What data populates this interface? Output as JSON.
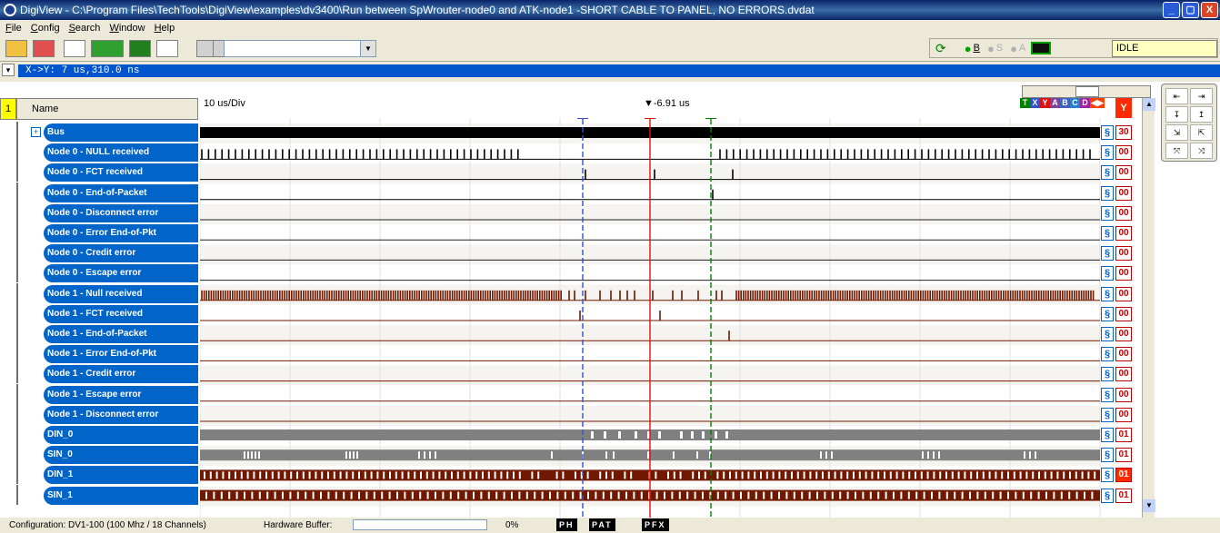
{
  "window": {
    "title": "DigiView - C:\\Program Files\\TechTools\\DigiView\\examples\\dv3400\\Run between SpWrouter-node0 and ATK-node1 -SHORT CABLE TO PANEL, NO ERRORS.dvdat",
    "buttons": [
      "_",
      "▢",
      "X"
    ]
  },
  "menu": [
    "File",
    "Config",
    "Search",
    "Window",
    "Help"
  ],
  "toolbar": {
    "combo_value": "",
    "run_labels": [
      "B",
      "S",
      "A"
    ],
    "status": "IDLE"
  },
  "xy": {
    "expand": "▾",
    "readout": "X->Y:  7 us,310.0 ns"
  },
  "grid": {
    "row_marker": "1",
    "name_header": "Name",
    "time_div": "10 us/Div",
    "cursor_label": "▼-6.91 us",
    "marker_legend": [
      "T",
      "X",
      "Y",
      "A",
      "B",
      "C",
      "D"
    ],
    "colors": {
      "x": "#3050d0",
      "y": "#e01010",
      "t": "#008000",
      "bus": "#000000",
      "dark": "#701800",
      "gray": "#808080"
    }
  },
  "signals": [
    {
      "name": "Bus",
      "value": "30",
      "expand": "+",
      "kind": "bus"
    },
    {
      "name": "Node 0 - NULL received",
      "value": "00",
      "kind": "ticks0"
    },
    {
      "name": "Node 0 - FCT received",
      "value": "00",
      "kind": "fct0"
    },
    {
      "name": "Node 0 - End-of-Packet",
      "value": "00",
      "kind": "eop0"
    },
    {
      "name": "Node 0 - Disconnect error",
      "value": "00",
      "kind": "flat0"
    },
    {
      "name": "Node 0 - Error End-of-Pkt",
      "value": "00",
      "kind": "flat0"
    },
    {
      "name": "Node 0 - Credit error",
      "value": "00",
      "kind": "flat0"
    },
    {
      "name": "Node 0 - Escape error",
      "value": "00",
      "kind": "flat0"
    },
    {
      "name": "Node 1 - Null received",
      "value": "00",
      "kind": "ticks1"
    },
    {
      "name": "Node 1 - FCT received",
      "value": "00",
      "kind": "fct1"
    },
    {
      "name": "Node 1 - End-of-Packet",
      "value": "00",
      "kind": "eop1"
    },
    {
      "name": "Node 1 - Error End-of-Pkt",
      "value": "00",
      "kind": "flat1"
    },
    {
      "name": "Node 1 - Credit error",
      "value": "00",
      "kind": "flat1"
    },
    {
      "name": "Node 1 - Escape error",
      "value": "00",
      "kind": "flat1"
    },
    {
      "name": "Node 1 - Disconnect error",
      "value": "00",
      "kind": "flat1"
    },
    {
      "name": "DIN_0",
      "value": "01",
      "kind": "din0"
    },
    {
      "name": "SIN_0",
      "value": "01",
      "kind": "sin0"
    },
    {
      "name": "DIN_1",
      "value": "01",
      "kind": "din1",
      "hot": true
    },
    {
      "name": "SIN_1",
      "value": "01",
      "kind": "sin1"
    }
  ],
  "trigger_glyph": "§",
  "palette": [
    "⇤",
    "⇥",
    "↧",
    "↥",
    "⇲",
    "⇱",
    "⤧",
    "⤨"
  ],
  "statusbar": {
    "configuration": "Configuration:  DV1-100 (100 Mhz / 18 Channels)",
    "hardware_buffer_label": "Hardware Buffer:",
    "hardware_buffer_pct": "0%",
    "tags": [
      "PH",
      "PAT",
      "PFX"
    ]
  }
}
